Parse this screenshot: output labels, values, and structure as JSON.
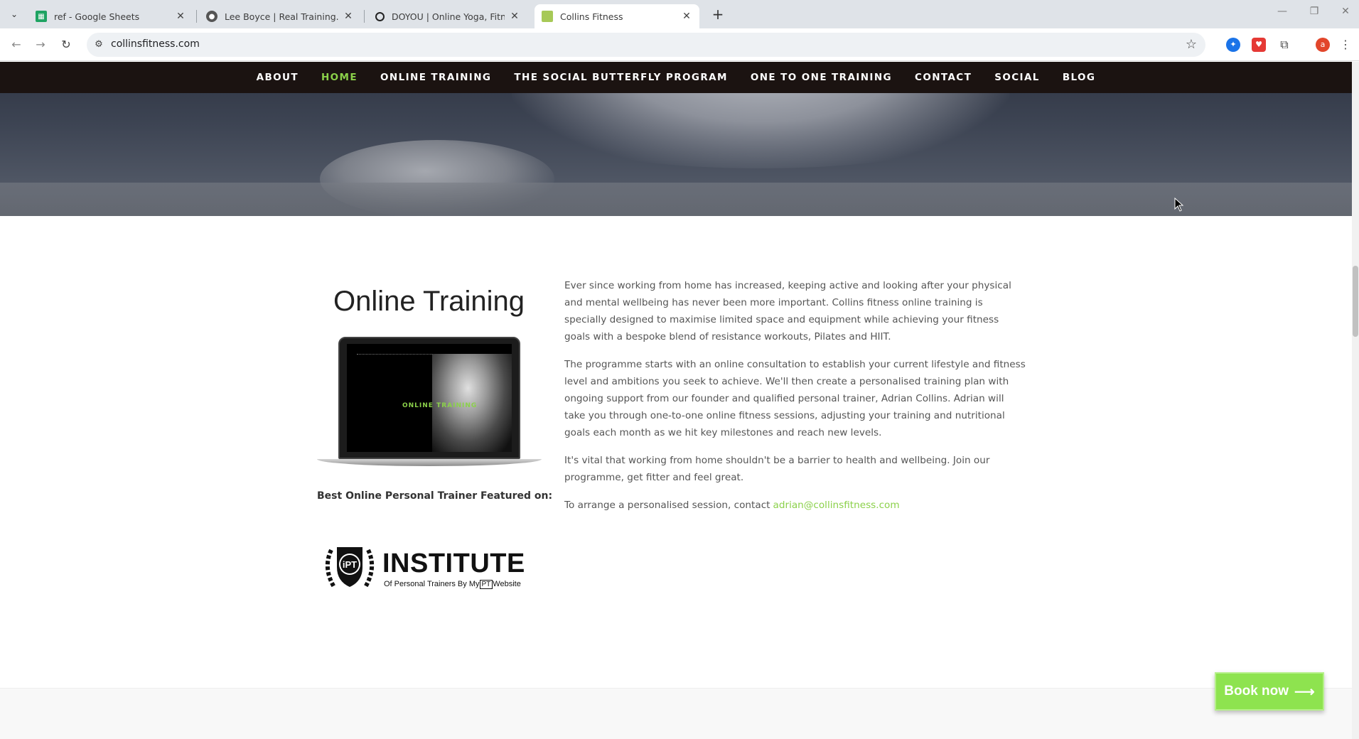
{
  "browser": {
    "tabs": [
      {
        "title": "ref - Google Sheets",
        "icon": "sheets-icon",
        "color": "#1ea362"
      },
      {
        "title": "Lee Boyce | Real Training. No N",
        "icon": "profile-icon",
        "color": "#333333"
      },
      {
        "title": "DOYOU | Online Yoga, Fitness, &",
        "icon": "circle-icon",
        "color": "#222222"
      },
      {
        "title": "Collins Fitness",
        "icon": "collins-favicon",
        "color": "#a7c957"
      }
    ],
    "active_tab_index": 3,
    "url": "collinsfitness.com"
  },
  "nav": {
    "items": [
      "ABOUT",
      "HOME",
      "ONLINE TRAINING",
      "THE SOCIAL BUTTERFLY PROGRAM",
      "ONE TO ONE TRAINING",
      "CONTACT",
      "SOCIAL",
      "BLOG"
    ],
    "active": "HOME",
    "active_color": "#8bd14a"
  },
  "online_training": {
    "title": "Online Training",
    "laptop_screen_text": "ONLINE TRAINING",
    "featured_label": "Best Online Personal Trainer Featured on:",
    "logo_big": "INSTITUTE",
    "logo_small": "Of Personal Trainers By My",
    "logo_pt": "PT",
    "logo_website": "Website",
    "logo_badge": "iPT",
    "paragraphs": [
      "Ever since working from home has increased, keeping active and looking after your physical and mental wellbeing has never been more important.  Collins fitness online training is specially designed to maximise limited space and equipment while achieving your fitness goals with a bespoke blend of resistance workouts, Pilates and HIIT.",
      "The programme starts with an online consultation to establish your current lifestyle and fitness level and ambitions you seek to achieve. We'll then create a personalised training plan with ongoing support from our founder and qualified personal trainer, Adrian Collins. Adrian will take you through one-to-one online fitness sessions, adjusting your training and nutritional goals each month as we hit key milestones and reach new levels.",
      "It's vital that working from home shouldn't be a barrier to health and wellbeing. Join our programme, get fitter and feel great."
    ],
    "contact_prefix": "To arrange a personalised session, contact",
    "contact_email": "adrian@collinsfitness.com"
  },
  "book_now": {
    "label": "Book now",
    "arrow": "⟶"
  },
  "colors": {
    "accent": "#8bd14a",
    "nav_bg": "#1b1311",
    "book_bg": "#8ee34f"
  }
}
